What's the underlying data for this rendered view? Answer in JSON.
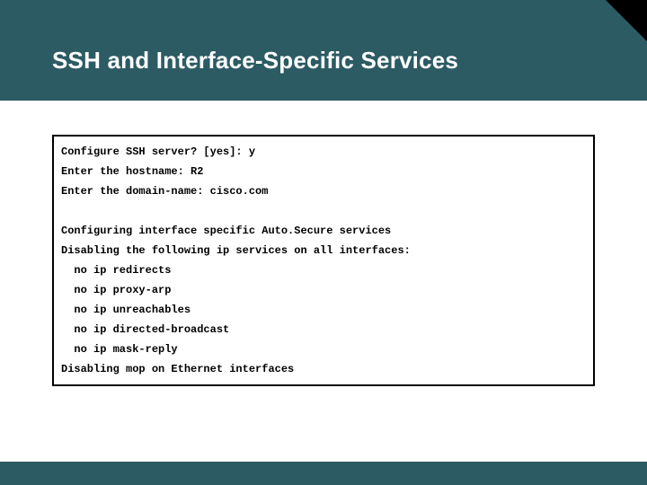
{
  "header": {
    "title": "SSH and Interface-Specific Services"
  },
  "terminal": {
    "l1": "Configure SSH server? [yes]: y",
    "l2": "Enter the hostname: R2",
    "l3": "Enter the domain-name: cisco.com",
    "l4": "Configuring interface specific Auto.Secure services",
    "l5": "Disabling the following ip services on all interfaces:",
    "l6": "  no ip redirects",
    "l7": "  no ip proxy-arp",
    "l8": "  no ip unreachables",
    "l9": "  no ip directed-broadcast",
    "l10": "  no ip mask-reply",
    "l11": "Disabling mop on Ethernet interfaces"
  }
}
